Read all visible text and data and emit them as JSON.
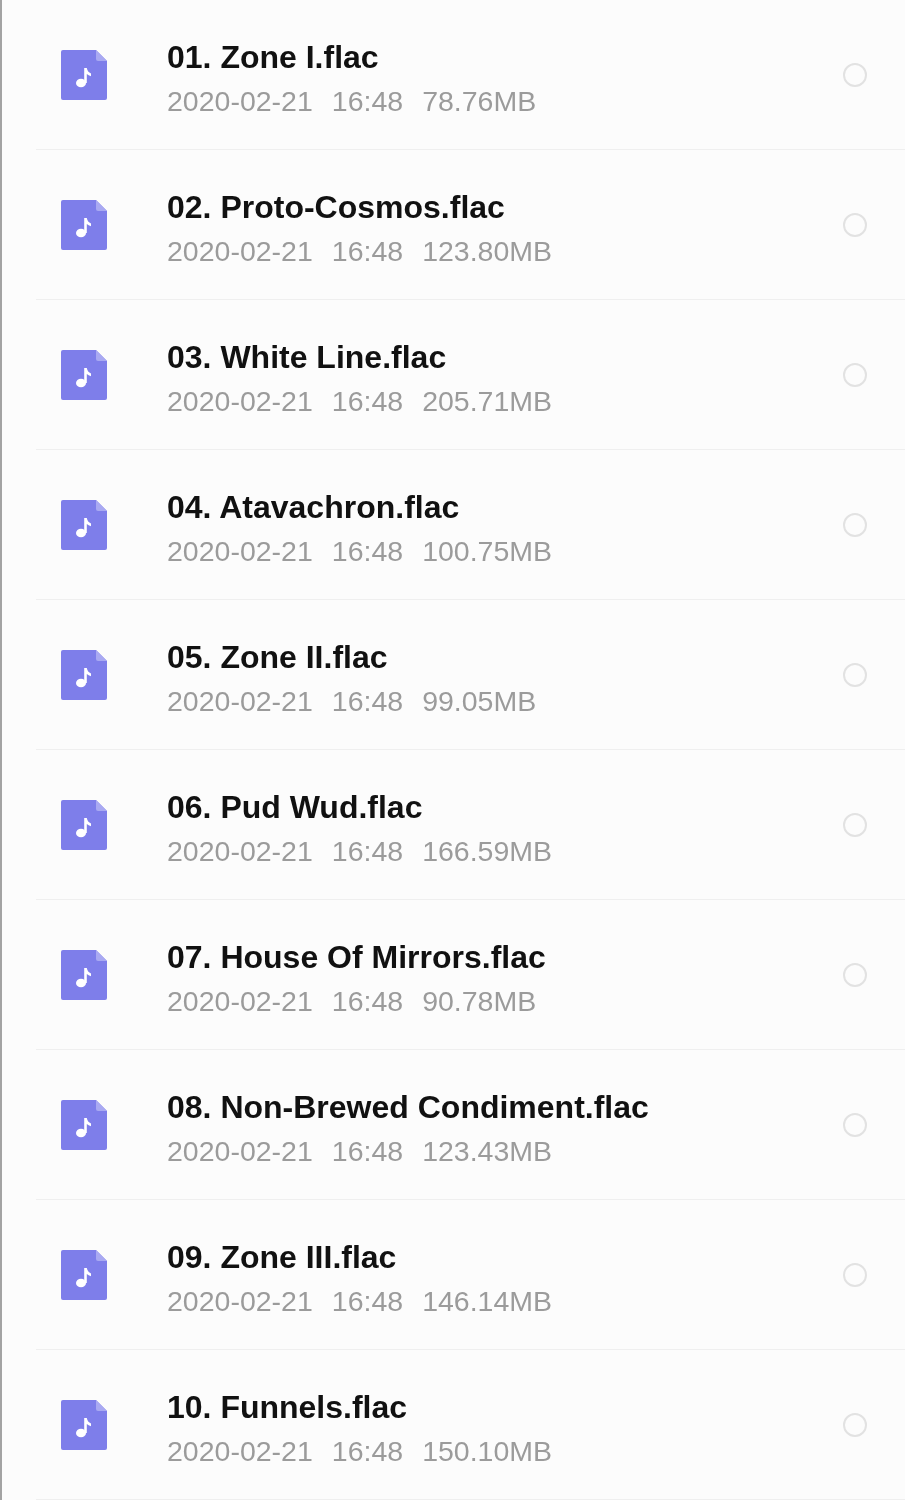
{
  "files": [
    {
      "name": "01. Zone I.flac",
      "date": "2020-02-21",
      "time": "16:48",
      "size": "78.76MB",
      "selected": false
    },
    {
      "name": "02. Proto-Cosmos.flac",
      "date": "2020-02-21",
      "time": "16:48",
      "size": "123.80MB",
      "selected": false
    },
    {
      "name": "03. White Line.flac",
      "date": "2020-02-21",
      "time": "16:48",
      "size": "205.71MB",
      "selected": false
    },
    {
      "name": "04. Atavachron.flac",
      "date": "2020-02-21",
      "time": "16:48",
      "size": "100.75MB",
      "selected": false
    },
    {
      "name": "05. Zone II.flac",
      "date": "2020-02-21",
      "time": "16:48",
      "size": "99.05MB",
      "selected": false
    },
    {
      "name": "06. Pud Wud.flac",
      "date": "2020-02-21",
      "time": "16:48",
      "size": "166.59MB",
      "selected": false
    },
    {
      "name": "07. House Of Mirrors.flac",
      "date": "2020-02-21",
      "time": "16:48",
      "size": "90.78MB",
      "selected": false
    },
    {
      "name": "08. Non-Brewed Condiment.flac",
      "date": "2020-02-21",
      "time": "16:48",
      "size": "123.43MB",
      "selected": false
    },
    {
      "name": "09. Zone III.flac",
      "date": "2020-02-21",
      "time": "16:48",
      "size": "146.14MB",
      "selected": false
    },
    {
      "name": "10. Funnels.flac",
      "date": "2020-02-21",
      "time": "16:48",
      "size": "150.10MB",
      "selected": false
    }
  ]
}
